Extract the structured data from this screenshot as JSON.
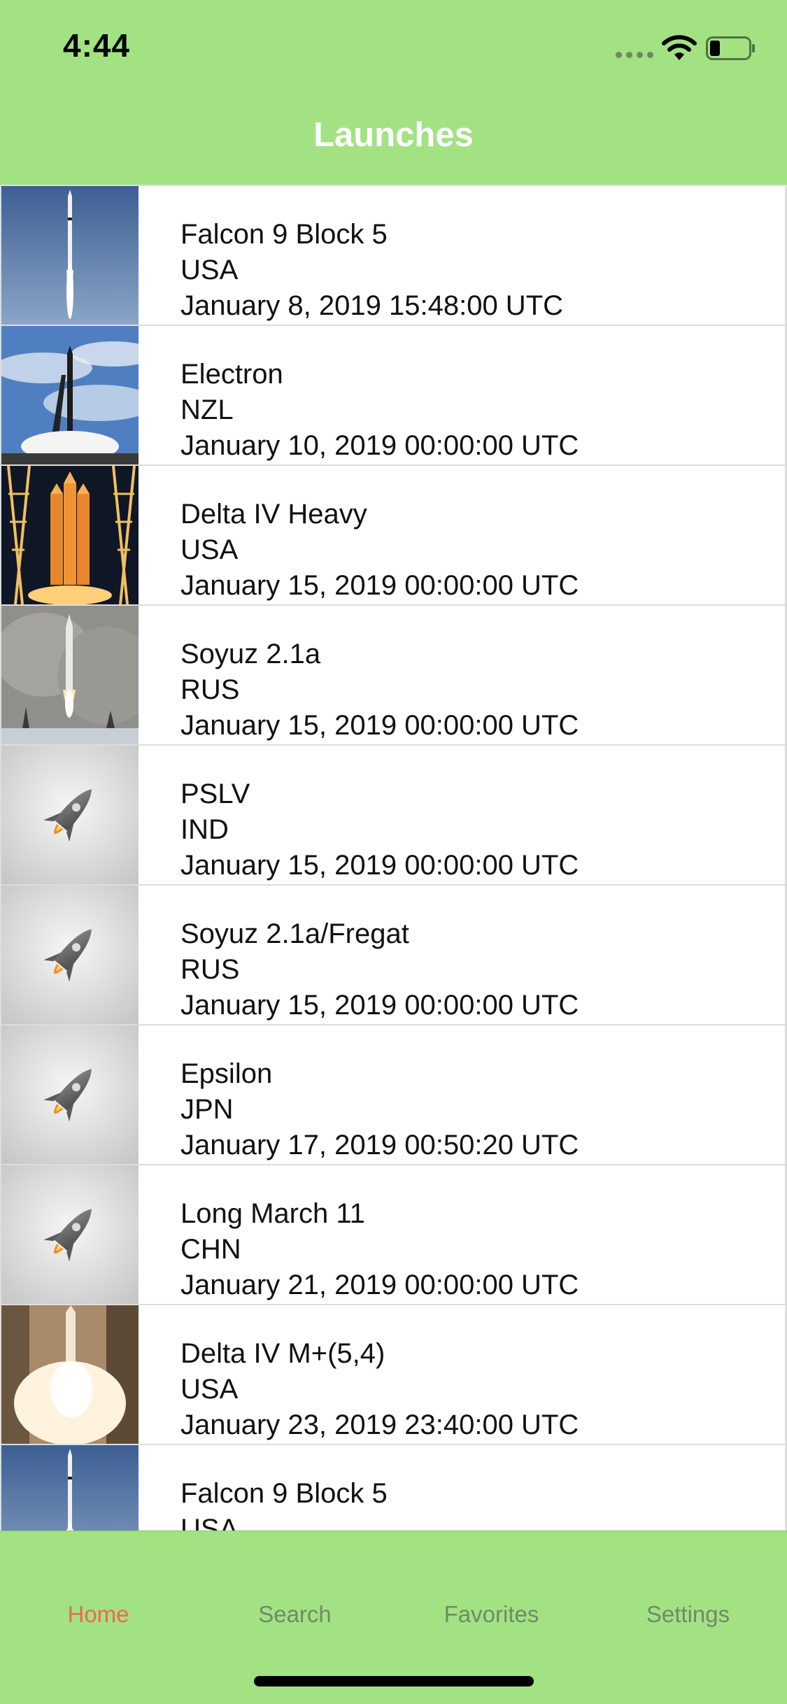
{
  "status_bar": {
    "time": "4:44"
  },
  "nav": {
    "title": "Launches"
  },
  "launches": [
    {
      "name": "Falcon 9 Block 5",
      "country": "USA",
      "date": "January 8, 2019 15:48:00 UTC",
      "thumbnail": "photo-falcon-launch"
    },
    {
      "name": "Electron",
      "country": "NZL",
      "date": "January 10, 2019 00:00:00 UTC",
      "thumbnail": "photo-electron-pad"
    },
    {
      "name": "Delta IV Heavy",
      "country": "USA",
      "date": "January 15, 2019 00:00:00 UTC",
      "thumbnail": "photo-delta-heavy-night"
    },
    {
      "name": "Soyuz 2.1a",
      "country": "RUS",
      "date": "January 15, 2019 00:00:00 UTC",
      "thumbnail": "photo-soyuz-launch"
    },
    {
      "name": "PSLV",
      "country": "IND",
      "date": "January 15, 2019 00:00:00 UTC",
      "thumbnail": "rocket-placeholder-icon"
    },
    {
      "name": "Soyuz 2.1a/Fregat",
      "country": "RUS",
      "date": "January 15, 2019 00:00:00 UTC",
      "thumbnail": "rocket-placeholder-icon"
    },
    {
      "name": "Epsilon",
      "country": "JPN",
      "date": "January 17, 2019 00:50:20 UTC",
      "thumbnail": "rocket-placeholder-icon"
    },
    {
      "name": "Long March 11",
      "country": "CHN",
      "date": "January 21, 2019 00:00:00 UTC",
      "thumbnail": "rocket-placeholder-icon"
    },
    {
      "name": "Delta IV M+(5,4)",
      "country": "USA",
      "date": "January 23, 2019 23:40:00 UTC",
      "thumbnail": "photo-delta-launch"
    },
    {
      "name": "Falcon 9 Block 5",
      "country": "USA",
      "date": "",
      "thumbnail": "photo-falcon-launch"
    }
  ],
  "tabs": [
    {
      "label": "Home",
      "active": true
    },
    {
      "label": "Search",
      "active": false
    },
    {
      "label": "Favorites",
      "active": false
    },
    {
      "label": "Settings",
      "active": false
    }
  ],
  "colors": {
    "bar_background": "#a3e283",
    "active_tab": "#ee6a4a",
    "inactive_tab": "#6f8a68",
    "title_text": "#ffffff"
  }
}
